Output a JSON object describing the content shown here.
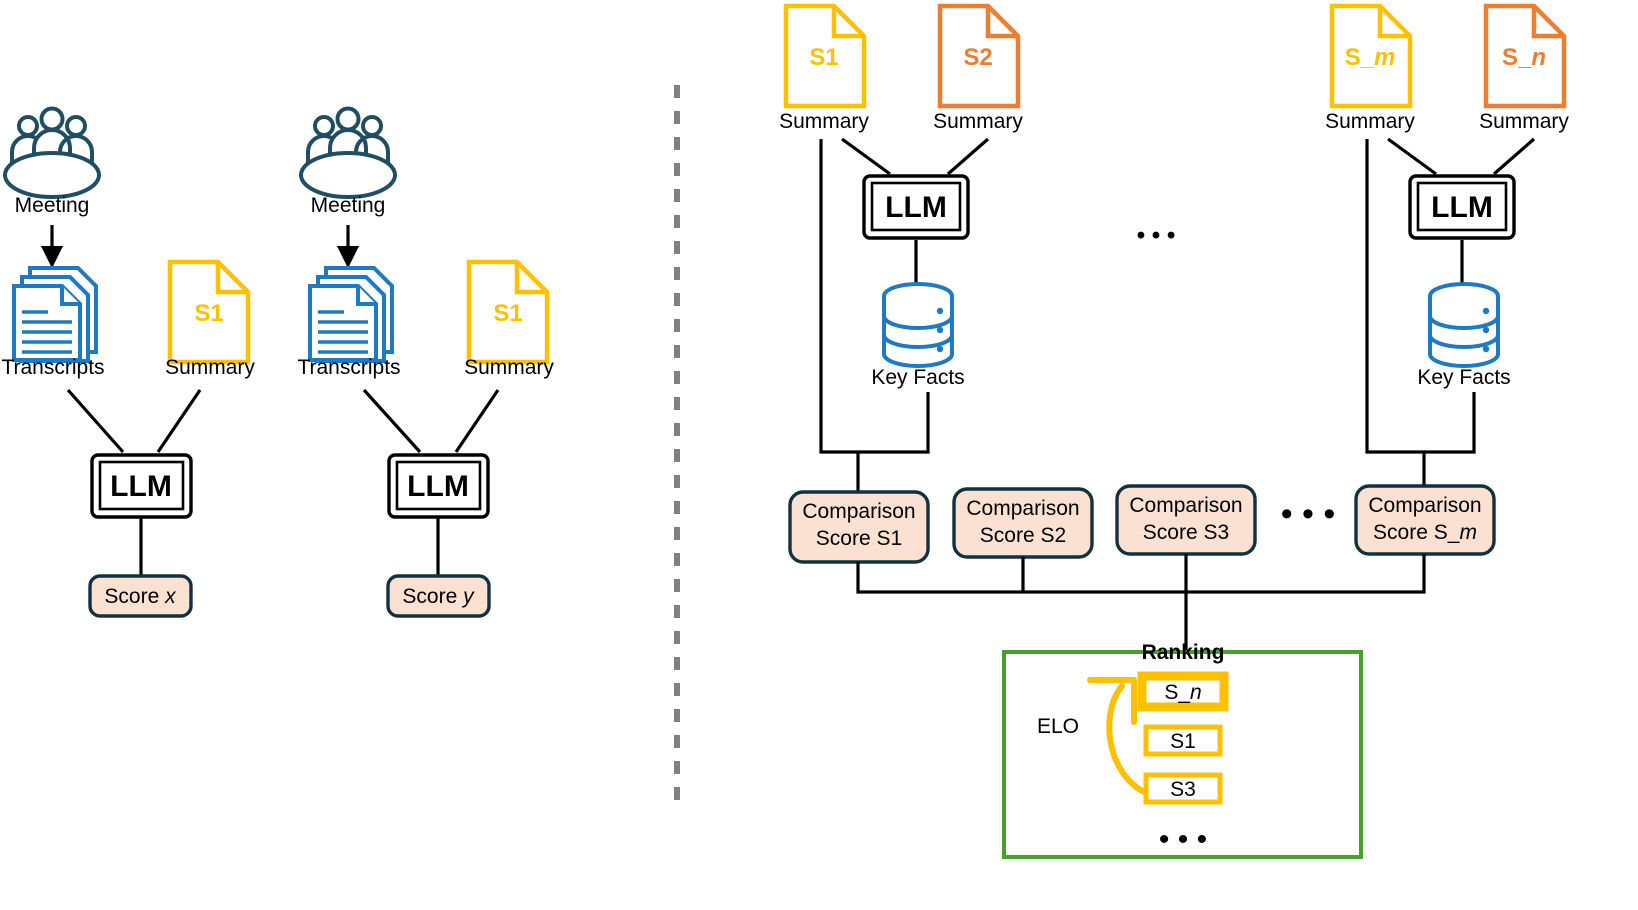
{
  "figure": {
    "title": "LLM summary evaluation pipeline",
    "divider": {
      "name": "vertical-dashed-divider",
      "color": "#808080"
    }
  },
  "colors": {
    "summary_yellow": "#FFC000",
    "summary_orange": "#ED7D31",
    "transcript_blue": "#1F7AC4",
    "meeting_navy": "#1F4E63",
    "score_fill": "#FBE1D1",
    "score_border": "#13303F",
    "ranking_green": "#46A02C",
    "black": "#000000"
  },
  "left_panel": {
    "groups": [
      {
        "meeting_label": "Meeting",
        "transcripts_label": "Transcripts",
        "summary_tag": "S1",
        "summary_label": "Summary",
        "llm_label": "LLM",
        "score_prefix": "Score ",
        "score_var": "x"
      },
      {
        "meeting_label": "Meeting",
        "transcripts_label": "Transcripts",
        "summary_tag": "S1",
        "summary_label": "Summary",
        "llm_label": "LLM",
        "score_prefix": "Score ",
        "score_var": "y"
      }
    ]
  },
  "right_panel": {
    "clusters": [
      {
        "left_doc": {
          "tag": "S1",
          "tag_italic": "",
          "label": "Summary",
          "color": "#FFC000"
        },
        "right_doc": {
          "tag": "S2",
          "tag_italic": "",
          "label": "Summary",
          "color": "#ED7D31"
        },
        "llm_label": "LLM",
        "keyfacts_label": "Key Facts"
      },
      {
        "left_doc": {
          "tag": "S_",
          "tag_italic": "m",
          "label": "Summary",
          "color": "#FFC000"
        },
        "right_doc": {
          "tag": "S_",
          "tag_italic": "n",
          "label": "Summary",
          "color": "#ED7D31"
        },
        "llm_label": "LLM",
        "keyfacts_label": "Key Facts"
      }
    ],
    "cluster_ellipsis": "• • •",
    "comparison_scores": [
      {
        "line1": "Comparison",
        "line2": "Score S1",
        "line2_italic": ""
      },
      {
        "line1": "Comparison",
        "line2": "Score S2",
        "line2_italic": ""
      },
      {
        "line1": "Comparison",
        "line2": "Score S3",
        "line2_italic": ""
      },
      {
        "line1": "Comparison",
        "line2": "Score S_",
        "line2_italic": "m"
      }
    ],
    "score_ellipsis": "• • •",
    "ranking": {
      "title": "Ranking",
      "elo_label": "ELO",
      "items": [
        {
          "text": "S_",
          "italic": "n",
          "highlighted": true
        },
        {
          "text": "S1",
          "italic": "",
          "highlighted": false
        },
        {
          "text": "S3",
          "italic": "",
          "highlighted": false
        }
      ],
      "ellipsis": "• • •"
    }
  }
}
